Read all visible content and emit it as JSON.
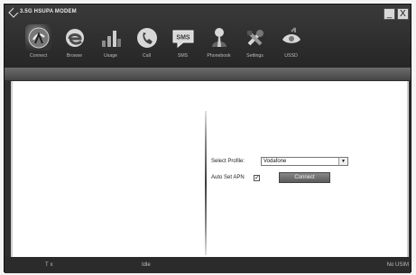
{
  "window": {
    "title": "3.5G HSUPA MODEM",
    "minimize_glyph": "_",
    "close_glyph": "X"
  },
  "toolbar": [
    {
      "label": "Connect",
      "icon": "connect-icon"
    },
    {
      "label": "Browse",
      "icon": "browse-icon"
    },
    {
      "label": "Usage",
      "icon": "usage-icon"
    },
    {
      "label": "Call",
      "icon": "call-icon"
    },
    {
      "label": "SMS",
      "icon": "sms-icon"
    },
    {
      "label": "Phonebook",
      "icon": "phonebook-icon"
    },
    {
      "label": "Settings",
      "icon": "settings-icon"
    },
    {
      "label": "USSD",
      "icon": "ussd-icon"
    }
  ],
  "sms_icon_text": "SMS",
  "form": {
    "select_profile_label": "Select Profile:",
    "profile_value": "Vodafone",
    "auto_set_apn_label": "Auto Set APN",
    "auto_set_apn_checked": "✓",
    "connect_label": "Connect"
  },
  "status": {
    "signal_glyph": "T",
    "signal_suffix": "x",
    "connection_text": "Idle",
    "device_text": "No USIM"
  }
}
